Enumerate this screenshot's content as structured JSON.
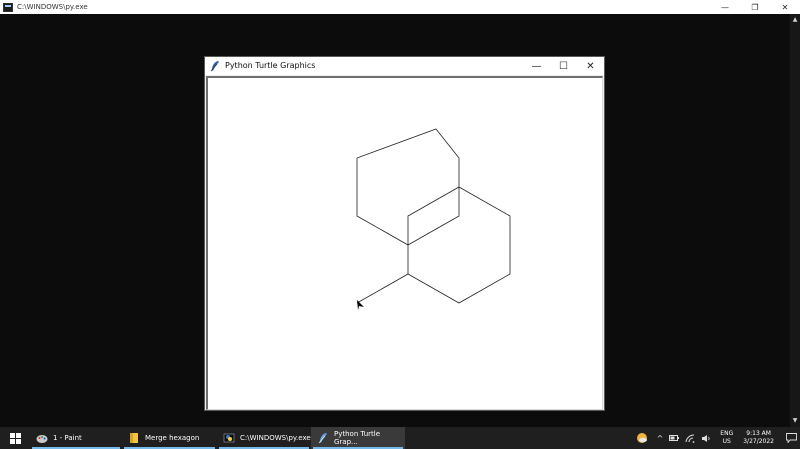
{
  "console": {
    "title": "C:\\WINDOWS\\py.exe",
    "minimize": "—",
    "maximize": "❐",
    "close": "✕",
    "scroll_up": "▲",
    "scroll_down": "▼"
  },
  "turtle_window": {
    "title": "Python Turtle Graphics",
    "minimize": "—",
    "maximize": "☐",
    "close": "✕"
  },
  "taskbar": {
    "items": [
      {
        "label": "1 - Paint",
        "icon": "paint-icon"
      },
      {
        "label": "Merge hexagon",
        "icon": "folder-icon"
      },
      {
        "label": "C:\\WINDOWS\\py.exe",
        "icon": "python-console-icon"
      },
      {
        "label": "Python Turtle Grap...",
        "icon": "feather-icon"
      }
    ],
    "tray": {
      "chevron": "^",
      "lang_top": "ENG",
      "lang_bottom": "US",
      "time": "9:13 AM",
      "date": "3/27/2022"
    }
  },
  "colors": {
    "accent": "#76b9ed",
    "console_bg": "#0c0c0c",
    "taskbar_bg": "#1f1f1f"
  }
}
